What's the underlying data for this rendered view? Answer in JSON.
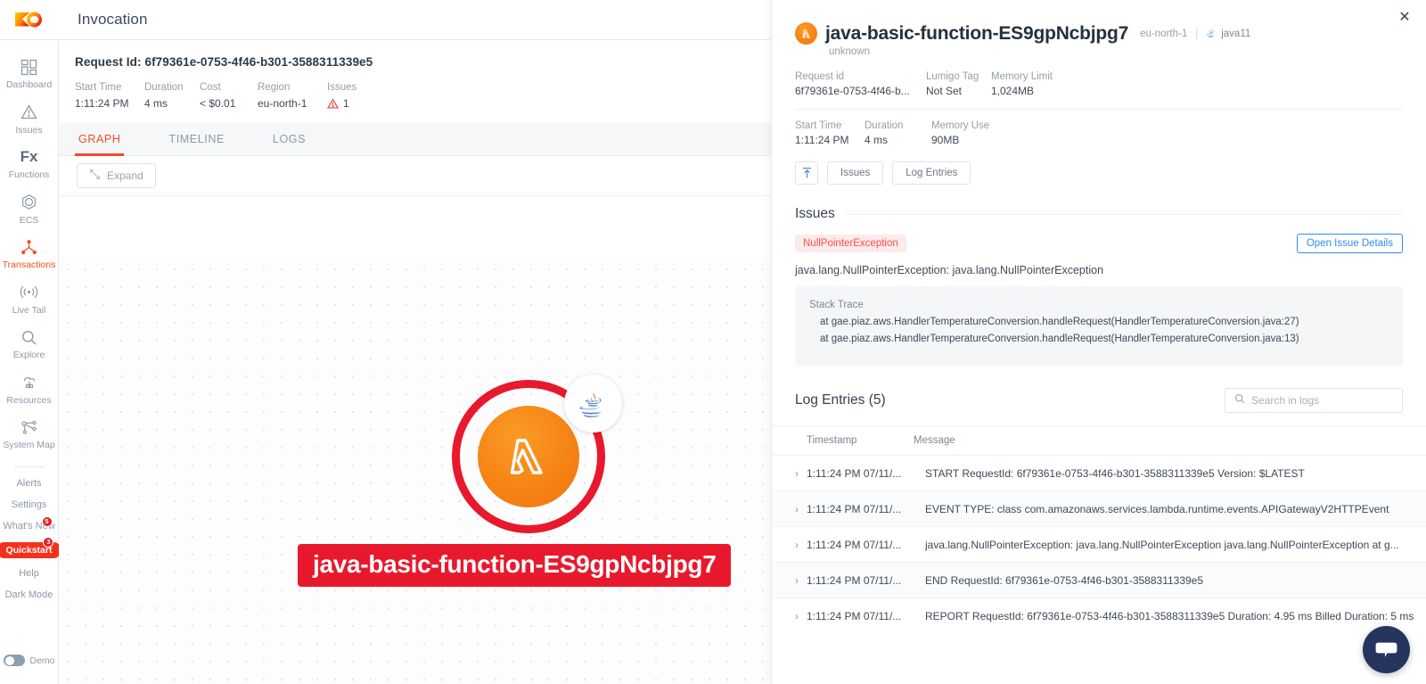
{
  "topbar": {
    "title": "Invocation",
    "logo_icon": "lumigo-logo-icon"
  },
  "sidebar": {
    "items": [
      {
        "label": "Dashboard",
        "icon": "dashboard-grid-icon",
        "active": false
      },
      {
        "label": "Issues",
        "icon": "warning-triangle-icon",
        "active": false
      },
      {
        "label": "Functions",
        "icon": "fx-icon",
        "active": false
      },
      {
        "label": "ECS",
        "icon": "ecs-hexagon-icon",
        "active": false
      },
      {
        "label": "Transactions",
        "icon": "transactions-node-icon",
        "active": true
      },
      {
        "label": "Live Tail",
        "icon": "live-tail-broadcast-icon",
        "active": false
      },
      {
        "label": "Explore",
        "icon": "search-magnifier-icon",
        "active": false
      },
      {
        "label": "Resources",
        "icon": "resources-cloud-icon",
        "active": false
      },
      {
        "label": "System Map",
        "icon": "system-map-icon",
        "active": false
      }
    ],
    "text_items": [
      {
        "label": "Alerts",
        "badge": ""
      },
      {
        "label": "Settings",
        "badge": ""
      },
      {
        "label": "What's New",
        "badge": "5"
      }
    ],
    "quickstart": {
      "label": "Quickstart",
      "badge": "3"
    },
    "bottom_items": [
      {
        "label": "Help"
      },
      {
        "label": "Dark Mode"
      }
    ],
    "demo": {
      "label": "Demo",
      "on": false
    }
  },
  "invocation": {
    "request_id_label": "Request Id: 6f79361e-0753-4f46-b301-3588311339e5",
    "meta": [
      {
        "key": "Start Time",
        "value": "1:11:24 PM"
      },
      {
        "key": "Duration",
        "value": "4 ms"
      },
      {
        "key": "Cost",
        "value": "< $0.01"
      },
      {
        "key": "Region",
        "value": "eu-north-1"
      },
      {
        "key": "Issues",
        "value": "1"
      }
    ],
    "tabs": [
      {
        "label": "GRAPH",
        "active": true
      },
      {
        "label": "TIMELINE",
        "active": false
      },
      {
        "label": "LOGS",
        "active": false
      }
    ],
    "toolbar": {
      "expand_label": "Expand",
      "expand_icon": "expand-arrows-icon",
      "zoom_out_icon": "zoom-minus-icon"
    },
    "graph_node": {
      "label": "java-basic-function-ES9gpNcbjpg7",
      "service_icon": "aws-lambda-icon",
      "runtime_icon": "java-coffee-cup-icon",
      "error_ring_color": "#e8192c",
      "node_color": "#f58113"
    }
  },
  "panel": {
    "close_icon": "close-icon",
    "function_name": "java-basic-function-ES9gpNcbjpg7",
    "region": "eu-north-1",
    "separator": "|",
    "runtime": "java11",
    "runtime_icon": "java-coffee-cup-icon",
    "lambda_icon": "aws-lambda-icon",
    "subtitle": "unknown",
    "kv_top": [
      {
        "key": "Request id",
        "value": "6f79361e-0753-4f46-b..."
      },
      {
        "key": "Lumigo Tag",
        "value": "Not Set"
      },
      {
        "key": "Memory Limit",
        "value": "1,024MB"
      }
    ],
    "kv_bottom": [
      {
        "key": "Start Time",
        "value": "1:11:24 PM"
      },
      {
        "key": "Duration",
        "value": "4 ms"
      },
      {
        "key": "Memory Use",
        "value": "90MB"
      }
    ],
    "buttons": [
      {
        "label": "",
        "icon": "jump-to-top-arrow-icon"
      },
      {
        "label": "Issues",
        "icon": ""
      },
      {
        "label": "Log Entries",
        "icon": ""
      }
    ],
    "issues": {
      "title": "Issues",
      "exception_badge": "NullPointerException",
      "open_details_label": "Open Issue Details",
      "message": "java.lang.NullPointerException: java.lang.NullPointerException",
      "stack_trace_title": "Stack Trace",
      "stack_lines": [
        "at gae.piaz.aws.HandlerTemperatureConversion.handleRequest(HandlerTemperatureConversion.java:27)",
        "at gae.piaz.aws.HandlerTemperatureConversion.handleRequest(HandlerTemperatureConversion.java:13)"
      ]
    },
    "logs": {
      "title": "Log Entries (5)",
      "search_placeholder": "Search in logs",
      "search_value": "",
      "search_icon": "search-magnifier-icon",
      "columns": [
        "Timestamp",
        "Message"
      ],
      "rows": [
        {
          "timestamp": "1:11:24 PM 07/11/...",
          "message": "START RequestId: 6f79361e-0753-4f46-b301-3588311339e5 Version: $LATEST"
        },
        {
          "timestamp": "1:11:24 PM 07/11/...",
          "message": "EVENT TYPE: class com.amazonaws.services.lambda.runtime.events.APIGatewayV2HTTPEvent"
        },
        {
          "timestamp": "1:11:24 PM 07/11/...",
          "message": "java.lang.NullPointerException: java.lang.NullPointerException java.lang.NullPointerException at g..."
        },
        {
          "timestamp": "1:11:24 PM 07/11/...",
          "message": "END RequestId: 6f79361e-0753-4f46-b301-3588311339e5"
        },
        {
          "timestamp": "1:11:24 PM 07/11/...",
          "message": "REPORT RequestId: 6f79361e-0753-4f46-b301-3588311339e5 Duration: 4.95 ms Billed Duration: 5 ms"
        }
      ]
    }
  },
  "chat_widget": {
    "icon": "chat-bubble-icon"
  },
  "colors": {
    "accent": "#f04d23",
    "error": "#e8192c",
    "link": "#2d8cf0",
    "lambda": "#f58113"
  }
}
